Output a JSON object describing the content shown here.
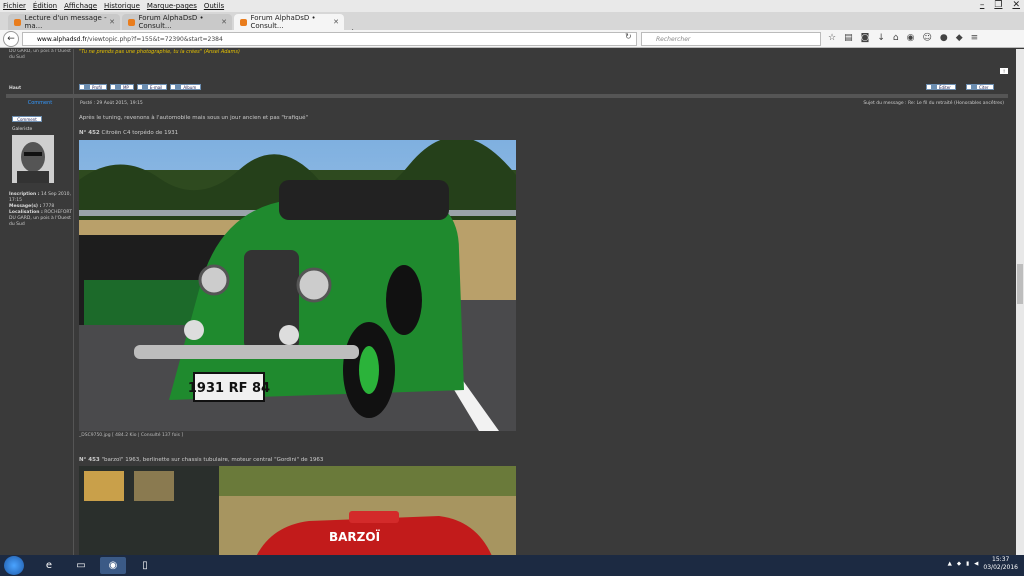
{
  "menu": [
    "Fichier",
    "Édition",
    "Affichage",
    "Historique",
    "Marque-pages",
    "Outils"
  ],
  "tabs": [
    {
      "label": "Lecture d'un message - ma..."
    },
    {
      "label": "Forum AlphaDsD • Consult..."
    },
    {
      "label": "Forum AlphaDsD • Consult..."
    }
  ],
  "url": {
    "domain": "www.alphadsd.fr",
    "path": "/viewtopic.php?f=155&t=72390&start=2384"
  },
  "search": {
    "placeholder": "Rechercher"
  },
  "prev_post": {
    "location_fragment": "DU GARD, un pois à l'Ouest du Sud",
    "quote": "\"Tu ne prends pas une photographie, tu la crées\" (Ansel Adams)",
    "haut": "Haut",
    "buttons": [
      "Profil",
      "MP",
      "E-mail",
      "Album"
    ],
    "right_buttons": [
      "Éditer",
      "Citer"
    ],
    "report": "!"
  },
  "post": {
    "meta": "Posté : 29 Août 2015, 19:15",
    "subject": "Sujet du message : Re: Le fil du retraité (Honorables ancêtres)",
    "author": "Comment",
    "rank": "Galeriste",
    "profile": [
      {
        "label": "Inscription :",
        "value": "14 Sep 2010, 17:15"
      },
      {
        "label": "Message(s) :",
        "value": "7778"
      },
      {
        "label": "Localisation :",
        "value": "ROCHEFORT DU GARD, un pois à l'Ouest du Sud"
      }
    ],
    "intro": "Après le tuning, revenons à l'automobile mais sous un jour ancien et pas \"trafiqué\"",
    "caption1_num": "N° 452",
    "caption1_text": "Citroën C4 torpédo de 1931",
    "file1": "_DSC9750.jpg [ 484.2 Kio | Consulté 137 fois ]",
    "caption2_num": "N° 453",
    "caption2_text": "\"barzoï\" 1963, berlinette sur chassis tubulaire, moteur central \"Gordini\" de 1963",
    "plate": "1931 RF 84",
    "barzoi": "BARZOÏ"
  },
  "taskbar": {
    "time": "15:37",
    "date": "03/02/2016"
  },
  "colors": {
    "accent": "#6b8db0",
    "quote": "#e6c200",
    "page_bg": "#3a3a3a"
  }
}
